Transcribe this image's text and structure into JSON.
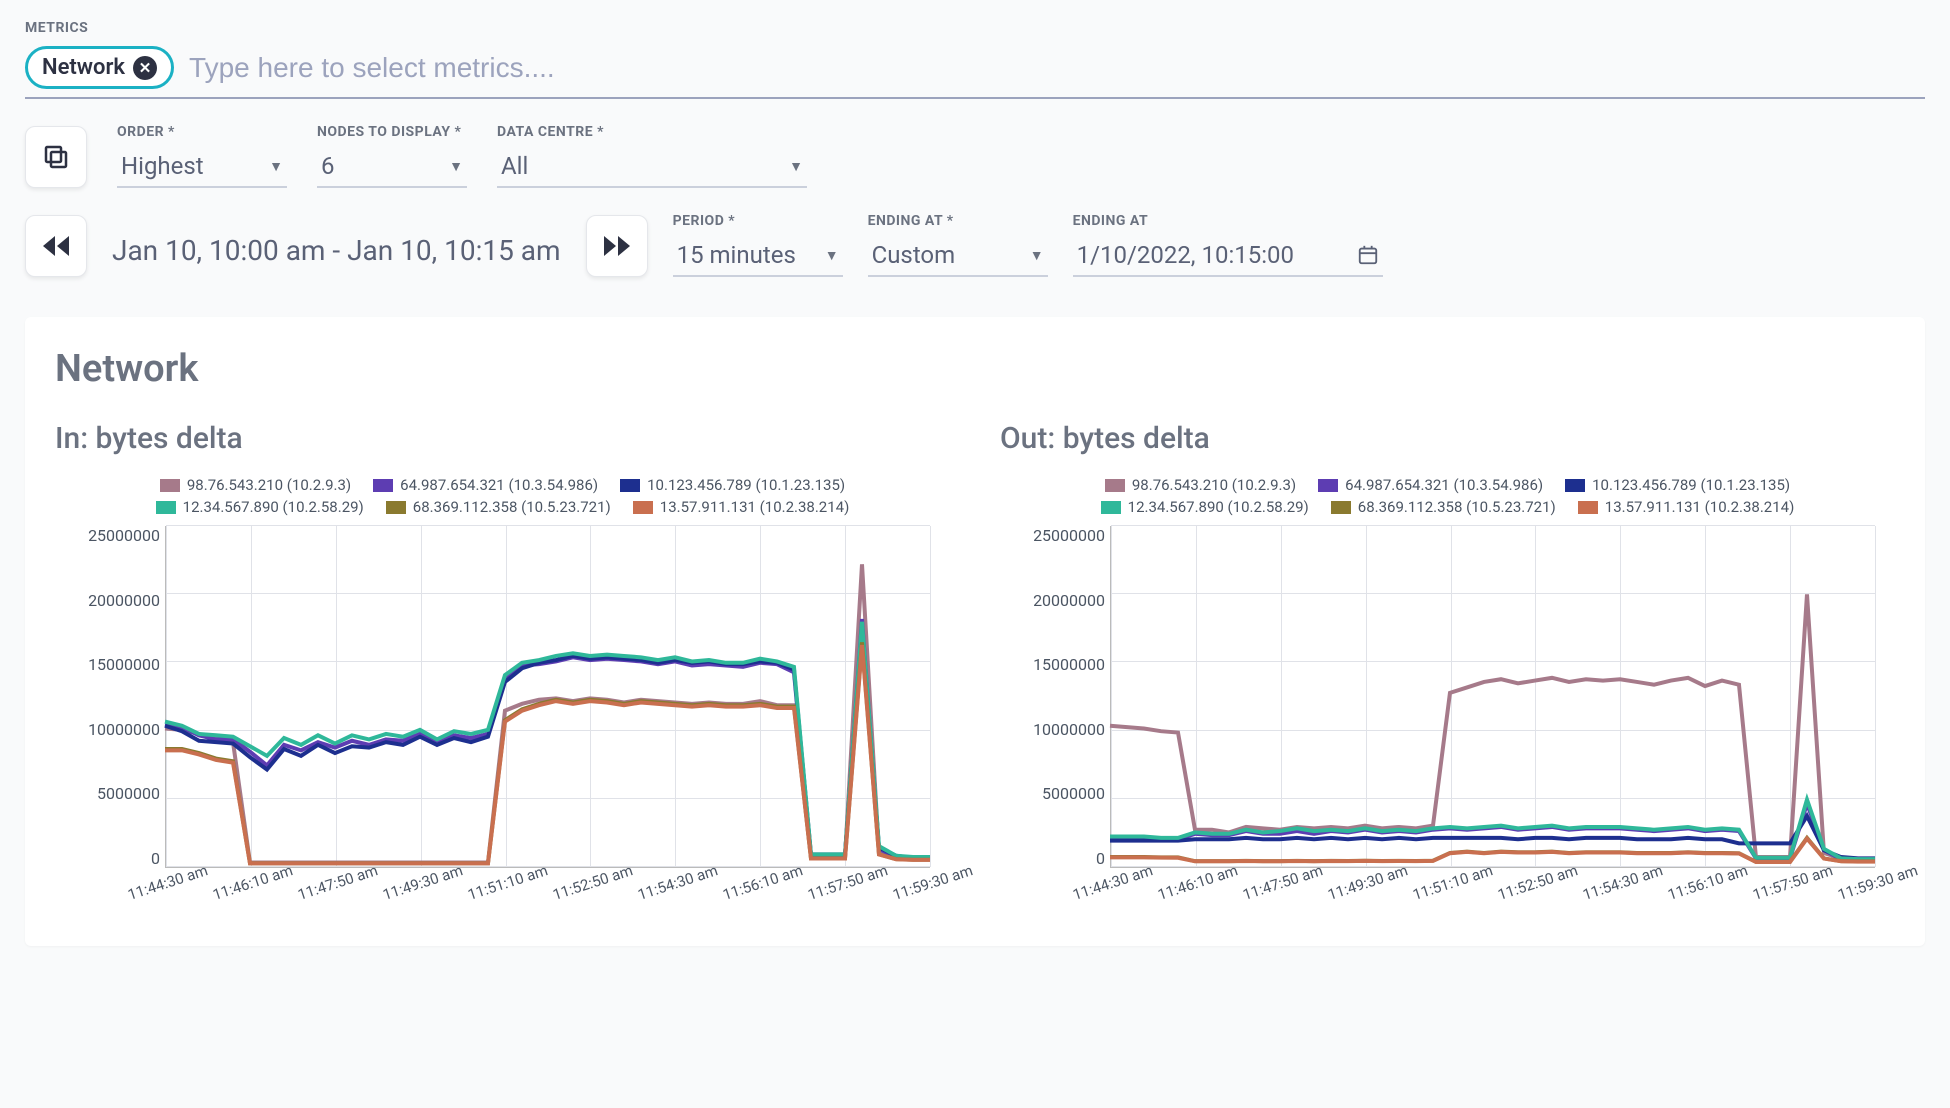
{
  "metrics_label": "METRICS",
  "chip_label": "Network",
  "metrics_placeholder": "Type here to select metrics....",
  "order": {
    "label": "ORDER *",
    "value": "Highest"
  },
  "nodes": {
    "label": "NODES TO DISPLAY *",
    "value": "6"
  },
  "datacentre": {
    "label": "DATA CENTRE *",
    "value": "All"
  },
  "time_range": "Jan 10, 10:00 am - Jan 10, 10:15 am",
  "period": {
    "label": "PERIOD *",
    "value": "15 minutes"
  },
  "ending_at_type": {
    "label": "ENDING AT *",
    "value": "Custom"
  },
  "ending_at_date": {
    "label": "ENDING AT",
    "value": "1/10/2022, 10:15:00"
  },
  "panel_title": "Network",
  "legend": [
    {
      "name": "98.76.543.210 (10.2.9.3)",
      "color": "#a67a8a"
    },
    {
      "name": "64.987.654.321 (10.3.54.986)",
      "color": "#5d3db2"
    },
    {
      "name": "10.123.456.789 (10.1.23.135)",
      "color": "#1d2f8f"
    },
    {
      "name": "12.34.567.890 (10.2.58.29)",
      "color": "#2fb89a"
    },
    {
      "name": "68.369.112.358 (10.5.23.721)",
      "color": "#8a7a2f"
    },
    {
      "name": "13.57.911.131 (10.2.38.214)",
      "color": "#c96f4f"
    }
  ],
  "chart_data": [
    {
      "type": "line",
      "title": "In: bytes delta",
      "xlabel": "",
      "ylabel": "",
      "ylim": [
        0,
        25000000
      ],
      "yticks": [
        0,
        5000000,
        10000000,
        15000000,
        20000000,
        25000000
      ],
      "xticks": [
        "11:44:30 am",
        "11:46:10 am",
        "11:47:50 am",
        "11:49:30 am",
        "11:51:10 am",
        "11:52:50 am",
        "11:54:30 am",
        "11:56:10 am",
        "11:57:50 am",
        "11:59:30 am"
      ],
      "num_points": 46,
      "series": [
        {
          "name": "98.76.543.210 (10.2.9.3)",
          "color": "#a67a8a",
          "values": [
            10200000,
            10100000,
            9800000,
            9500000,
            9200000,
            400000,
            400000,
            400000,
            400000,
            400000,
            400000,
            400000,
            400000,
            400000,
            400000,
            400000,
            400000,
            400000,
            400000,
            400000,
            11500000,
            12000000,
            12300000,
            12400000,
            12200000,
            12400000,
            12300000,
            12100000,
            12300000,
            12200000,
            12100000,
            12000000,
            12100000,
            12000000,
            12000000,
            12200000,
            11900000,
            11900000,
            800000,
            800000,
            800000,
            22200000,
            1100000,
            700000,
            650000,
            650000
          ]
        },
        {
          "name": "64.987.654.321 (10.3.54.986)",
          "color": "#5d3db2",
          "values": [
            10500000,
            10300000,
            9700000,
            9400000,
            9400000,
            8500000,
            7500000,
            9000000,
            8600000,
            9200000,
            8800000,
            9300000,
            9000000,
            9400000,
            9300000,
            9800000,
            9100000,
            9700000,
            9500000,
            9800000,
            13800000,
            14800000,
            14900000,
            15100000,
            15400000,
            15200000,
            15300000,
            15200000,
            15100000,
            14900000,
            15100000,
            14800000,
            14900000,
            14800000,
            14700000,
            15000000,
            14900000,
            14300000,
            900000,
            900000,
            900000,
            18200000,
            1400000,
            800000,
            700000,
            700000
          ]
        },
        {
          "name": "10.123.456.789 (10.1.23.135)",
          "color": "#1d2f8f",
          "values": [
            10400000,
            10000000,
            9300000,
            9200000,
            9100000,
            8100000,
            7200000,
            8700000,
            8200000,
            9000000,
            8400000,
            8900000,
            8800000,
            9200000,
            9000000,
            9600000,
            9000000,
            9500000,
            9200000,
            9600000,
            13600000,
            14600000,
            15000000,
            15200000,
            15500000,
            15300000,
            15400000,
            15300000,
            15200000,
            15000000,
            15200000,
            15000000,
            15100000,
            14900000,
            14900000,
            15100000,
            15000000,
            14500000,
            1000000,
            1000000,
            1000000,
            17700000,
            1500000,
            900000,
            750000,
            750000
          ]
        },
        {
          "name": "12.34.567.890 (10.2.58.29)",
          "color": "#2fb89a",
          "values": [
            10700000,
            10400000,
            9800000,
            9700000,
            9600000,
            8900000,
            8200000,
            9500000,
            9000000,
            9700000,
            9100000,
            9700000,
            9400000,
            9800000,
            9600000,
            10100000,
            9400000,
            10000000,
            9800000,
            10100000,
            14100000,
            15000000,
            15200000,
            15500000,
            15700000,
            15500000,
            15600000,
            15500000,
            15400000,
            15200000,
            15400000,
            15100000,
            15200000,
            15000000,
            15000000,
            15300000,
            15100000,
            14700000,
            1000000,
            1000000,
            1000000,
            18000000,
            1600000,
            900000,
            800000,
            800000
          ]
        },
        {
          "name": "68.369.112.358 (10.5.23.721)",
          "color": "#8a7a2f",
          "values": [
            8700000,
            8700000,
            8400000,
            8000000,
            7800000,
            350000,
            350000,
            350000,
            350000,
            350000,
            350000,
            350000,
            350000,
            350000,
            350000,
            350000,
            350000,
            350000,
            350000,
            350000,
            10800000,
            11600000,
            12000000,
            12300000,
            12100000,
            12300000,
            12200000,
            12000000,
            12200000,
            12100000,
            12000000,
            11900000,
            12000000,
            11900000,
            11900000,
            12000000,
            11800000,
            11800000,
            700000,
            700000,
            700000,
            16500000,
            1000000,
            650000,
            600000,
            600000
          ]
        },
        {
          "name": "13.57.911.131 (10.2.38.214)",
          "color": "#c96f4f",
          "values": [
            8600000,
            8600000,
            8300000,
            7900000,
            7700000,
            340000,
            340000,
            340000,
            340000,
            340000,
            340000,
            340000,
            340000,
            340000,
            340000,
            340000,
            340000,
            340000,
            340000,
            340000,
            10700000,
            11500000,
            11900000,
            12200000,
            12000000,
            12200000,
            12100000,
            11900000,
            12100000,
            12000000,
            11900000,
            11800000,
            11900000,
            11800000,
            11800000,
            11900000,
            11700000,
            11700000,
            690000,
            690000,
            690000,
            16300000,
            990000,
            640000,
            590000,
            590000
          ]
        }
      ]
    },
    {
      "type": "line",
      "title": "Out: bytes delta",
      "xlabel": "",
      "ylabel": "",
      "ylim": [
        0,
        25000000
      ],
      "yticks": [
        0,
        5000000,
        10000000,
        15000000,
        20000000,
        25000000
      ],
      "xticks": [
        "11:44:30 am",
        "11:46:10 am",
        "11:47:50 am",
        "11:49:30 am",
        "11:51:10 am",
        "11:52:50 am",
        "11:54:30 am",
        "11:56:10 am",
        "11:57:50 am",
        "11:59:30 am"
      ],
      "num_points": 46,
      "series": [
        {
          "name": "98.76.543.210 (10.2.9.3)",
          "color": "#a67a8a",
          "values": [
            10400000,
            10300000,
            10200000,
            10000000,
            9900000,
            2800000,
            2800000,
            2600000,
            3000000,
            2900000,
            2800000,
            3000000,
            2900000,
            3000000,
            2900000,
            3100000,
            2900000,
            3000000,
            2900000,
            3100000,
            12800000,
            13200000,
            13600000,
            13800000,
            13500000,
            13700000,
            13900000,
            13600000,
            13800000,
            13700000,
            13800000,
            13600000,
            13400000,
            13700000,
            13900000,
            13300000,
            13700000,
            13400000,
            800000,
            800000,
            800000,
            20000000,
            1100000,
            700000,
            650000,
            650000
          ]
        },
        {
          "name": "64.987.654.321 (10.3.54.986)",
          "color": "#5d3db2",
          "values": [
            2200000,
            2200000,
            2200000,
            2100000,
            2100000,
            2500000,
            2400000,
            2400000,
            2700000,
            2500000,
            2500000,
            2700000,
            2500000,
            2700000,
            2600000,
            2800000,
            2600000,
            2700000,
            2600000,
            2800000,
            2900000,
            2800000,
            2900000,
            3000000,
            2800000,
            2900000,
            3000000,
            2800000,
            2900000,
            2900000,
            2900000,
            2800000,
            2700000,
            2800000,
            2900000,
            2700000,
            2800000,
            2700000,
            700000,
            700000,
            700000,
            4700000,
            1300000,
            650000,
            620000,
            620000
          ]
        },
        {
          "name": "10.123.456.789 (10.1.23.135)",
          "color": "#1d2f8f",
          "values": [
            2000000,
            2000000,
            2000000,
            2000000,
            2000000,
            2100000,
            2100000,
            2100000,
            2200000,
            2100000,
            2100000,
            2200000,
            2100000,
            2200000,
            2100000,
            2200000,
            2100000,
            2200000,
            2100000,
            2200000,
            2200000,
            2200000,
            2200000,
            2200000,
            2100000,
            2200000,
            2200000,
            2100000,
            2200000,
            2200000,
            2200000,
            2100000,
            2100000,
            2100000,
            2200000,
            2100000,
            2100000,
            1800000,
            1800000,
            1800000,
            1800000,
            3800000,
            1300000,
            800000,
            700000,
            700000
          ]
        },
        {
          "name": "12.34.567.890 (10.2.58.29)",
          "color": "#2fb89a",
          "values": [
            2300000,
            2300000,
            2300000,
            2200000,
            2200000,
            2600000,
            2500000,
            2500000,
            2800000,
            2600000,
            2700000,
            2900000,
            2700000,
            2800000,
            2700000,
            2900000,
            2700000,
            2800000,
            2700000,
            2900000,
            3000000,
            2900000,
            3000000,
            3100000,
            2900000,
            3000000,
            3100000,
            2900000,
            3000000,
            3000000,
            3000000,
            2900000,
            2800000,
            2900000,
            3000000,
            2800000,
            2900000,
            2800000,
            750000,
            750000,
            750000,
            5000000,
            1400000,
            700000,
            650000,
            650000
          ]
        },
        {
          "name": "68.369.112.358 (10.5.23.721)",
          "color": "#8a7a2f",
          "values": [
            800000,
            800000,
            800000,
            780000,
            780000,
            500000,
            500000,
            500000,
            520000,
            500000,
            500000,
            520000,
            500000,
            520000,
            510000,
            530000,
            510000,
            520000,
            510000,
            530000,
            1100000,
            1200000,
            1100000,
            1200000,
            1150000,
            1150000,
            1200000,
            1100000,
            1150000,
            1150000,
            1150000,
            1100000,
            1100000,
            1100000,
            1150000,
            1100000,
            1100000,
            1080000,
            450000,
            450000,
            450000,
            2200000,
            700000,
            500000,
            480000,
            480000
          ]
        },
        {
          "name": "13.57.911.131 (10.2.38.214)",
          "color": "#c96f4f",
          "values": [
            780000,
            780000,
            780000,
            760000,
            750000,
            490000,
            490000,
            490000,
            510000,
            490000,
            490000,
            510000,
            490000,
            510000,
            500000,
            520000,
            500000,
            510000,
            500000,
            520000,
            1080000,
            1180000,
            1080000,
            1180000,
            1130000,
            1130000,
            1180000,
            1080000,
            1130000,
            1130000,
            1130000,
            1080000,
            1080000,
            1080000,
            1130000,
            1080000,
            1080000,
            1060000,
            440000,
            440000,
            440000,
            2150000,
            690000,
            490000,
            470000,
            470000
          ]
        }
      ]
    }
  ]
}
